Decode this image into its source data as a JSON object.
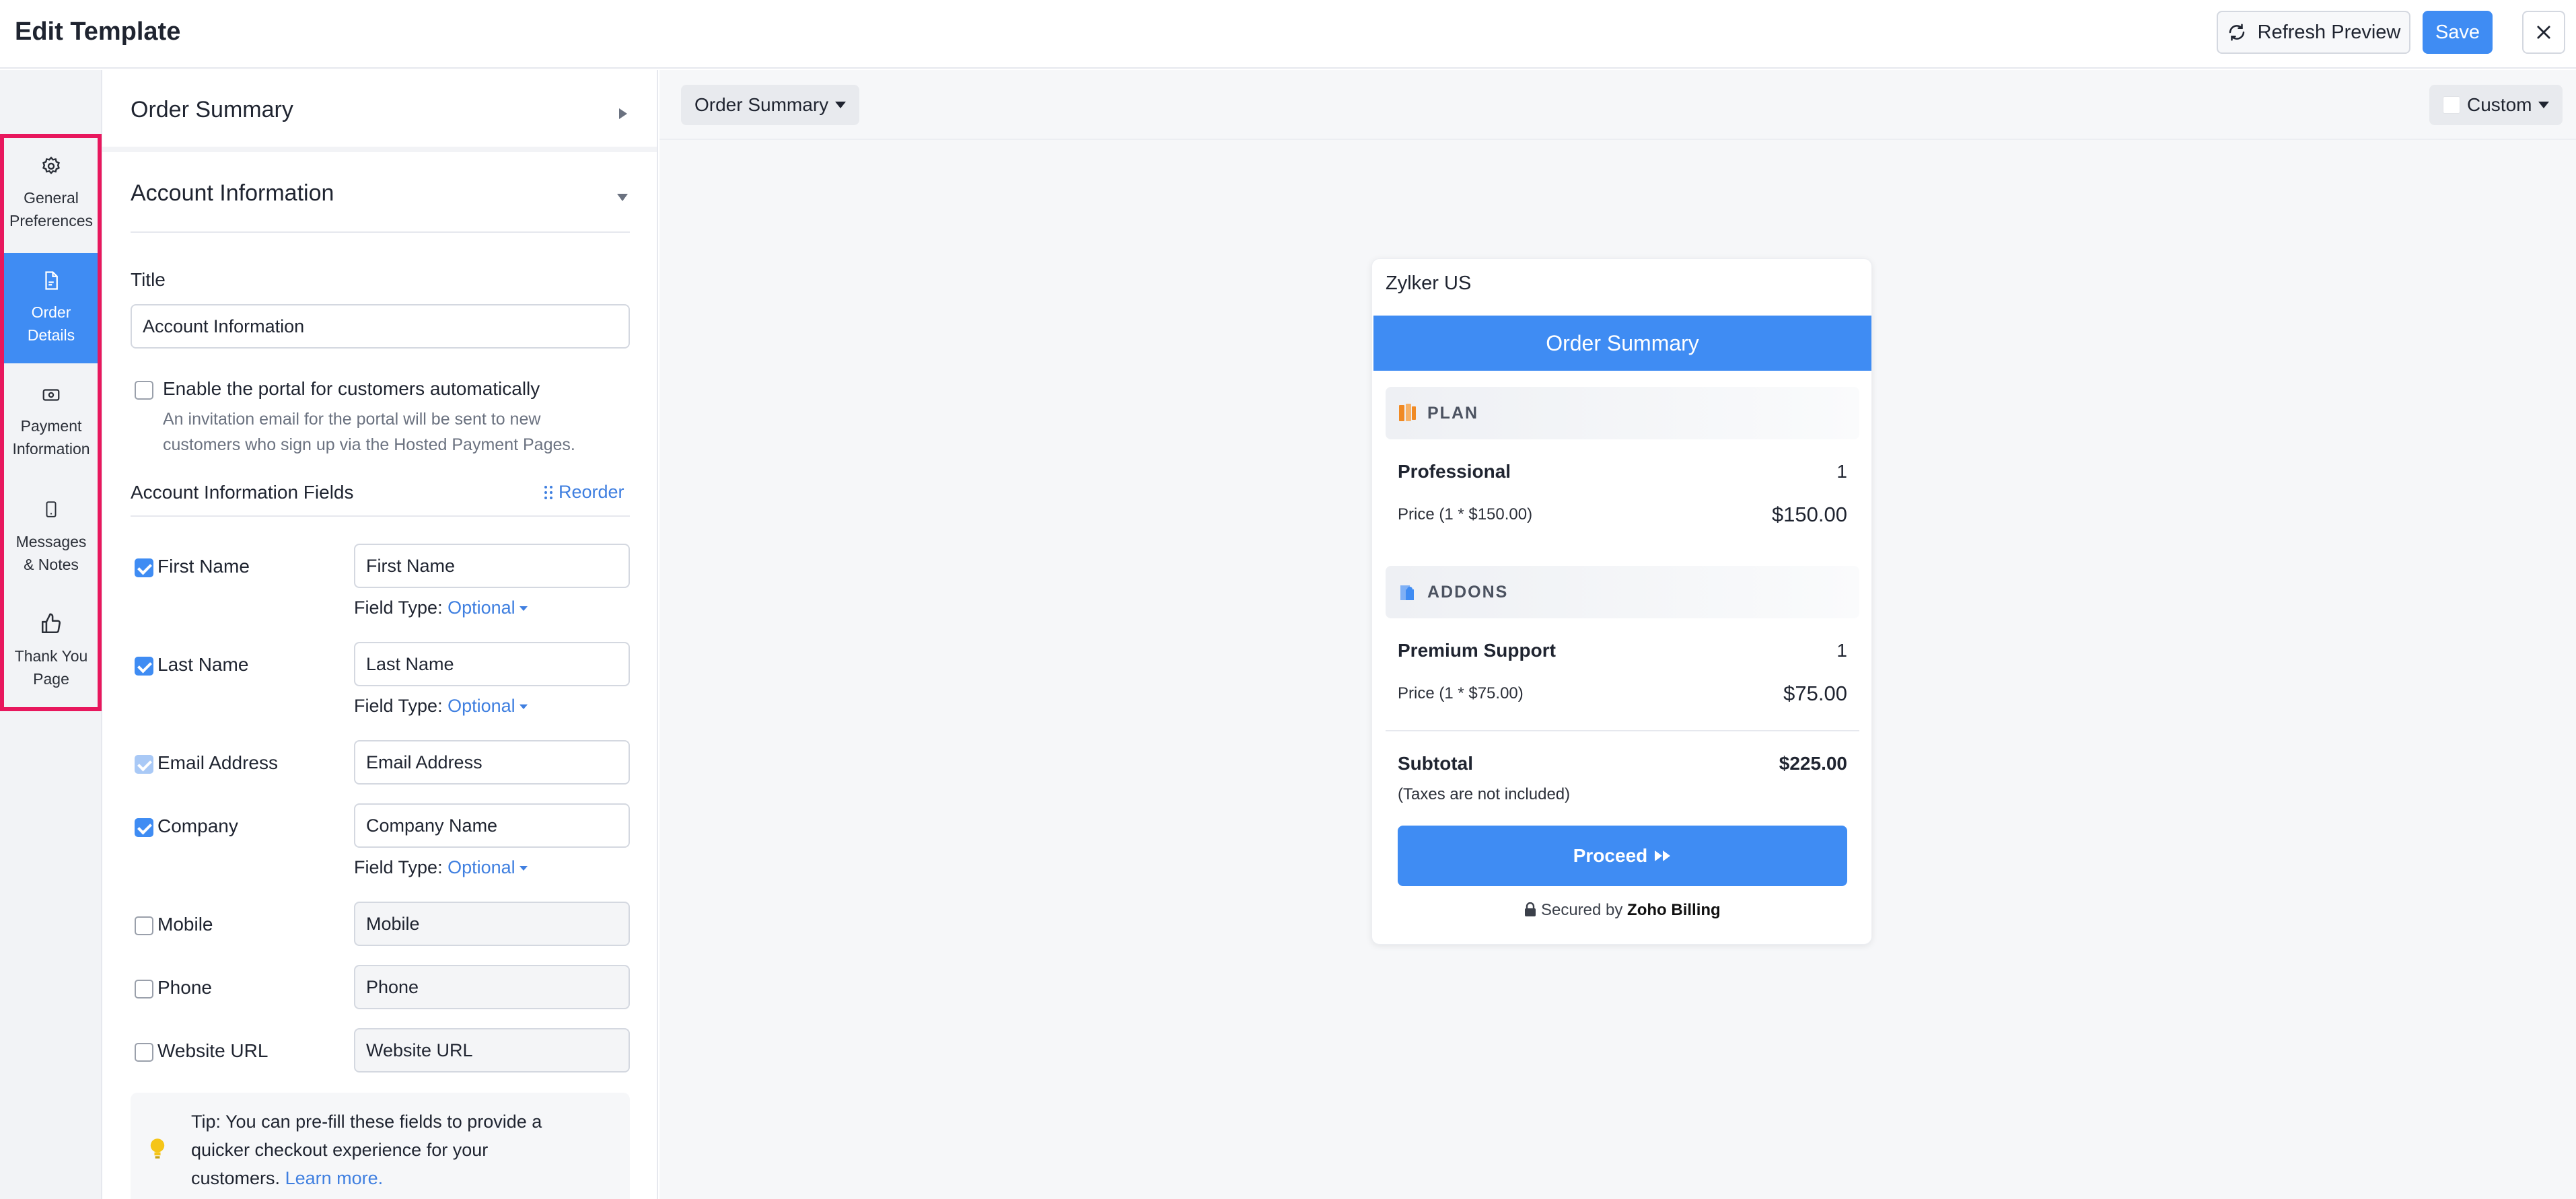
{
  "header": {
    "title": "Edit Template",
    "refresh_label": "Refresh Preview",
    "save_label": "Save"
  },
  "nav": [
    {
      "label_1": "General",
      "label_2": "Preferences",
      "icon": "gear-icon",
      "active": false
    },
    {
      "label_1": "Order",
      "label_2": "Details",
      "icon": "document-icon",
      "active": true
    },
    {
      "label_1": "Payment",
      "label_2": "Information",
      "icon": "payment-icon",
      "active": false
    },
    {
      "label_1": "Messages",
      "label_2": "& Notes",
      "icon": "mobile-icon",
      "active": false
    },
    {
      "label_1": "Thank You",
      "label_2": "Page",
      "icon": "thumbs-up-icon",
      "active": false
    }
  ],
  "panel": {
    "order_summary": "Order Summary",
    "account_info": "Account Information",
    "title_label": "Title",
    "title_value": "Account Information",
    "enable_portal": "Enable the portal for customers automatically",
    "enable_help_1": "An invitation email for the portal will be sent to new",
    "enable_help_2": "customers who sign up via the Hosted Payment Pages.",
    "fields_heading": "Account Information Fields",
    "reorder": "Reorder",
    "field_type_label": "Field Type:",
    "fields": [
      {
        "label": "First Name",
        "placeholder": "First Name",
        "checked": true,
        "type": "Optional"
      },
      {
        "label": "Last Name",
        "placeholder": "Last Name",
        "checked": true,
        "type": "Optional"
      },
      {
        "label": "Email Address",
        "placeholder": "Email Address",
        "checked": true,
        "disabled": true
      },
      {
        "label": "Company",
        "placeholder": "Company Name",
        "checked": true,
        "type": "Optional"
      },
      {
        "label": "Mobile",
        "placeholder": "Mobile",
        "checked": false
      },
      {
        "label": "Phone",
        "placeholder": "Phone",
        "checked": false
      },
      {
        "label": "Website URL",
        "placeholder": "Website URL",
        "checked": false
      }
    ],
    "tip_1": "Tip: You can pre-fill these fields to provide a",
    "tip_2": "quicker checkout experience for your",
    "tip_3": "customers.",
    "tip_link": "Learn more."
  },
  "preview": {
    "section_dropdown": "Order Summary",
    "device_dropdown": "Custom",
    "org": "Zylker US",
    "banner": "Order Summary",
    "plan_heading": "PLAN",
    "plan_name": "Professional",
    "plan_qty": "1",
    "plan_price_label": "Price (1 * $150.00)",
    "plan_amount": "$150.00",
    "addons_heading": "ADDONS",
    "addon_name": "Premium Support",
    "addon_qty": "1",
    "addon_price_label": "Price (1 * $75.00)",
    "addon_amount": "$75.00",
    "subtotal_label": "Subtotal",
    "subtotal_amount": "$225.00",
    "tax_note": "(Taxes are not included)",
    "proceed": "Proceed",
    "secured_by": "Secured by",
    "brand": "Zoho Billing"
  },
  "colors": {
    "accent": "#3f8cf3",
    "highlight": "#e8175d",
    "link": "#3f7fe0"
  }
}
